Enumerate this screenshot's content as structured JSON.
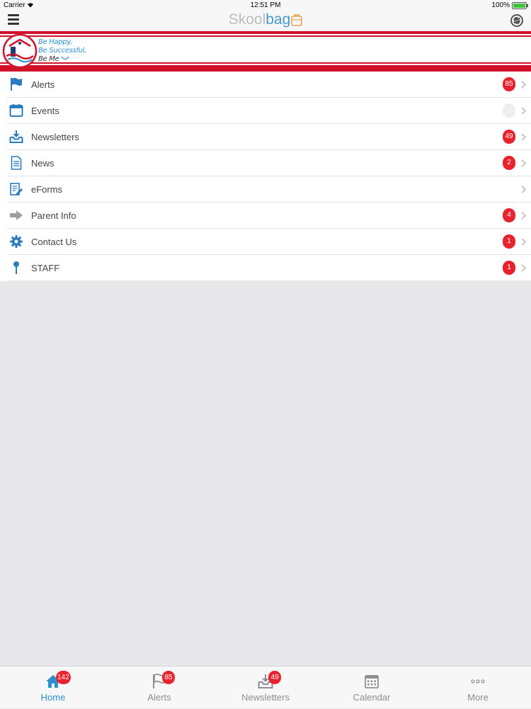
{
  "status_bar": {
    "carrier": "Carrier",
    "time": "12:51 PM",
    "battery": "100%"
  },
  "nav": {
    "title_part1": "Skool",
    "title_part2": "bag"
  },
  "banner": {
    "logo_text": "Latrobe Primary School",
    "slogan": [
      "Be Happy,",
      "Be Successful,",
      "Be Me"
    ]
  },
  "menu": [
    {
      "label": "Alerts",
      "badge": "85",
      "icon": "flag-icon"
    },
    {
      "label": "Events",
      "badge": "",
      "icon": "calendar-icon"
    },
    {
      "label": "Newsletters",
      "badge": "49",
      "icon": "inbox-download-icon"
    },
    {
      "label": "News",
      "badge": "2",
      "icon": "document-icon"
    },
    {
      "label": "eForms",
      "badge": "",
      "icon": "form-edit-icon"
    },
    {
      "label": "Parent Info",
      "badge": "4",
      "icon": "arrow-right-icon"
    },
    {
      "label": "Contact Us",
      "badge": "1",
      "icon": "gear-icon"
    },
    {
      "label": "STAFF",
      "badge": "1",
      "icon": "pin-icon"
    }
  ],
  "tabs": [
    {
      "label": "Home",
      "badge": "142",
      "icon": "home-icon"
    },
    {
      "label": "Alerts",
      "badge": "85",
      "icon": "flag-icon"
    },
    {
      "label": "Newsletters",
      "badge": "49",
      "icon": "inbox-download-icon"
    },
    {
      "label": "Calendar",
      "badge": "",
      "icon": "calendar-icon"
    },
    {
      "label": "More",
      "badge": "",
      "icon": "more-icon"
    }
  ],
  "colors": {
    "accent": "#2e8fcf",
    "badge": "#e8232e",
    "banner_red": "#d0132b"
  }
}
